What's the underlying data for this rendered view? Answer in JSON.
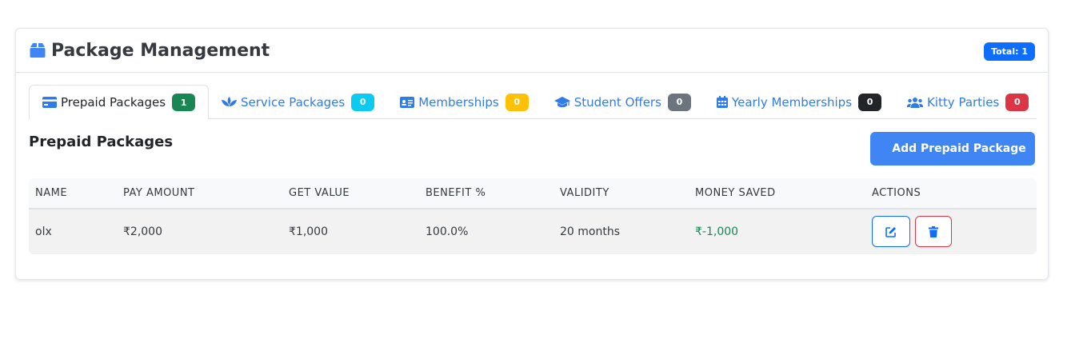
{
  "header": {
    "title": "Package Management",
    "total_label": "Total: 1",
    "icon": "box-icon"
  },
  "tabs": [
    {
      "label": "Prepaid Packages",
      "count": "1",
      "badge_color": "#198754",
      "icon": "credit-card-icon",
      "active": true
    },
    {
      "label": "Service Packages",
      "count": "0",
      "badge_color": "#0dcaf0",
      "icon": "spa-icon",
      "active": false
    },
    {
      "label": "Memberships",
      "count": "0",
      "badge_color": "#ffc107",
      "icon": "id-card-icon",
      "active": false
    },
    {
      "label": "Student Offers",
      "count": "0",
      "badge_color": "#6c757d",
      "icon": "graduation-cap-icon",
      "active": false
    },
    {
      "label": "Yearly Memberships",
      "count": "0",
      "badge_color": "#212529",
      "icon": "calendar-icon",
      "active": false
    },
    {
      "label": "Kitty Parties",
      "count": "0",
      "badge_color": "#dc3545",
      "icon": "users-icon",
      "active": false
    }
  ],
  "section": {
    "title": "Prepaid Packages",
    "add_label": "Add Prepaid Package"
  },
  "table": {
    "columns": [
      "NAME",
      "PAY AMOUNT",
      "GET VALUE",
      "BENEFIT %",
      "VALIDITY",
      "MONEY SAVED",
      "ACTIONS"
    ],
    "rows": [
      {
        "name": "olx",
        "pay_amount": "₹2,000",
        "get_value": "₹1,000",
        "benefit": "100.0%",
        "validity": "20 months",
        "money_saved": "₹-1,000"
      }
    ]
  },
  "colors": {
    "primary": "#0d6efd",
    "button": "#3f85f4",
    "success": "#198754",
    "danger": "#dc3545"
  }
}
